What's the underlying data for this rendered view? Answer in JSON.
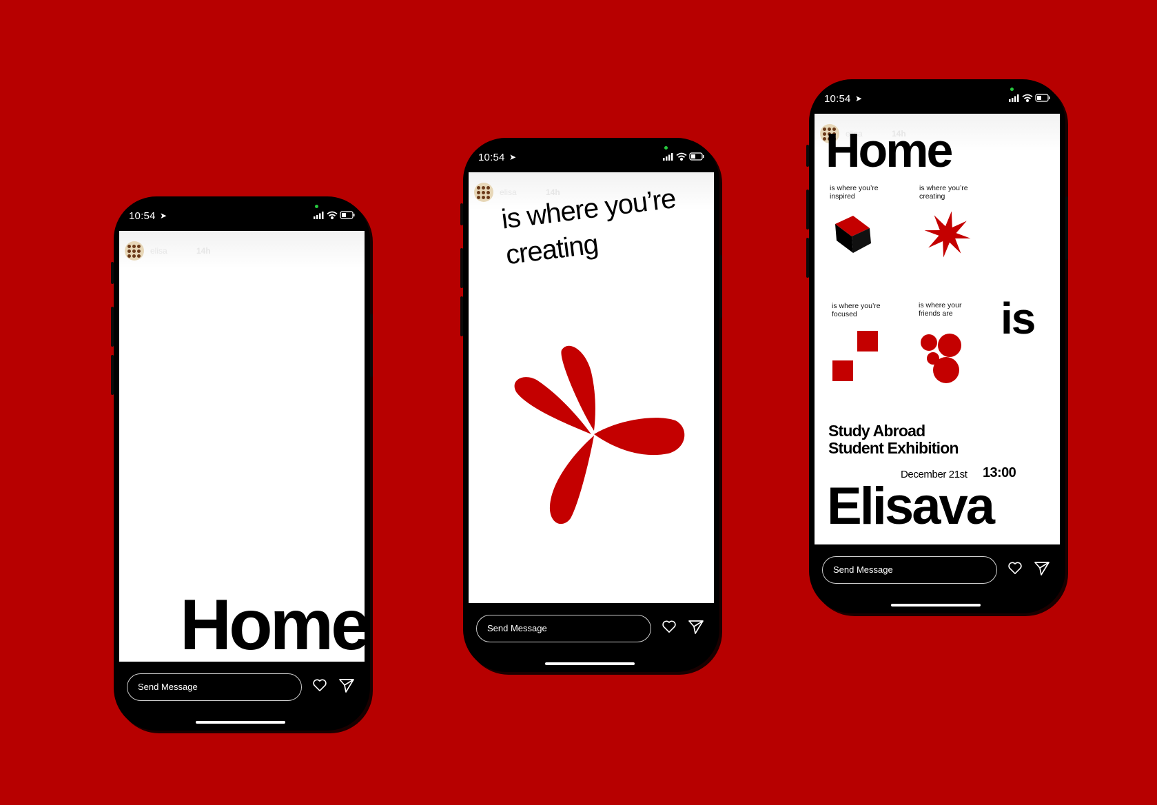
{
  "colors": {
    "background": "#b70000",
    "accent_red": "#c40000",
    "phone": "#000000"
  },
  "phones": [
    {
      "status": {
        "time": "10:54"
      },
      "story": {
        "username": "elisa",
        "posted": "14h"
      },
      "content": {
        "headline": "Home"
      },
      "bottom": {
        "message_placeholder": "Send Message"
      }
    },
    {
      "status": {
        "time": "10:54"
      },
      "story": {
        "username": "elisa",
        "posted": "14h"
      },
      "content": {
        "line1": "is where you’re",
        "line2": "creating"
      },
      "bottom": {
        "message_placeholder": "Send Message"
      }
    },
    {
      "status": {
        "time": "10:54"
      },
      "story": {
        "username": "elisa",
        "posted": "14h"
      },
      "content": {
        "headline": "Home",
        "items": [
          {
            "caption": "is where you’re inspired",
            "icon": "cube-icon"
          },
          {
            "caption": "is where you’re creating",
            "icon": "star-icon"
          },
          {
            "caption": "is where you’re focused",
            "icon": "squares-icon"
          },
          {
            "caption": "is where your friends are",
            "icon": "circles-icon"
          }
        ],
        "is_word": "is",
        "event_line1": "Study Abroad",
        "event_line2": "Student Exhibition",
        "date": "December 21st",
        "time": "13:00",
        "school": "Elisava"
      },
      "bottom": {
        "message_placeholder": "Send Message"
      }
    }
  ]
}
